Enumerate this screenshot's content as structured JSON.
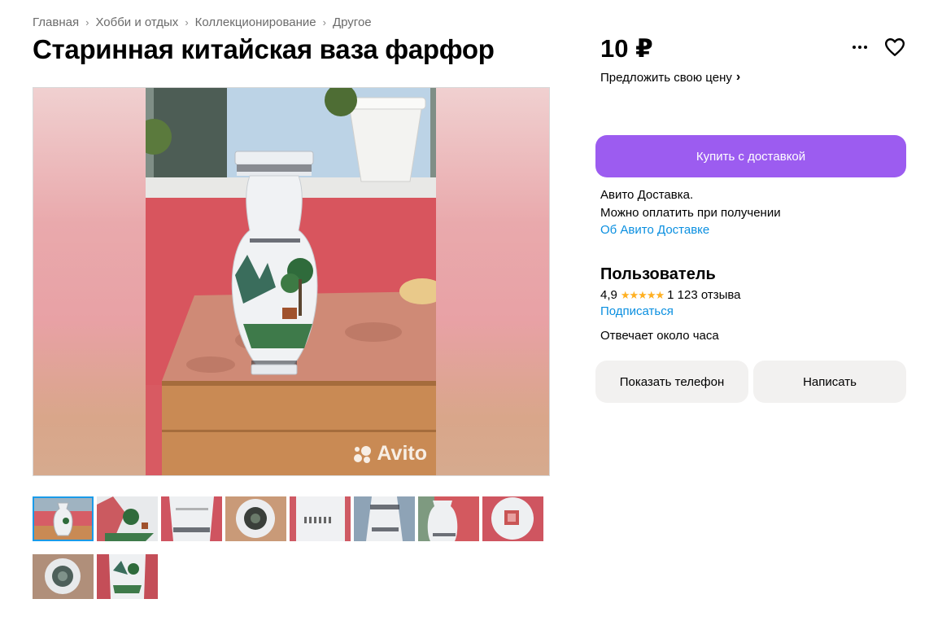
{
  "breadcrumbs": [
    "Главная",
    "Хобби и отдых",
    "Коллекционирование",
    "Другое"
  ],
  "title": "Старинная китайская ваза фарфор",
  "price": "10 ₽",
  "offer_price": "Предложить свою цену",
  "buy_button": "Купить с доставкой",
  "delivery": {
    "line1": "Авито Доставка.",
    "line2": "Можно оплатить при получении",
    "link": "Об Авито Доставке"
  },
  "seller": {
    "name": "Пользователь",
    "rating": "4,9",
    "stars": "★★★★★",
    "reviews": "1 123 отзыва",
    "subscribe": "Подписаться",
    "responds": "Отвечает около часа"
  },
  "buttons": {
    "phone": "Показать телефон",
    "write": "Написать"
  },
  "watermark": "Avito",
  "thumbnails_count": 10,
  "colors": {
    "accent_purple": "#9c5cf0",
    "link_blue": "#0a8fe0",
    "star_yellow": "#ffb021",
    "thumb_active": "#1a9be9"
  }
}
